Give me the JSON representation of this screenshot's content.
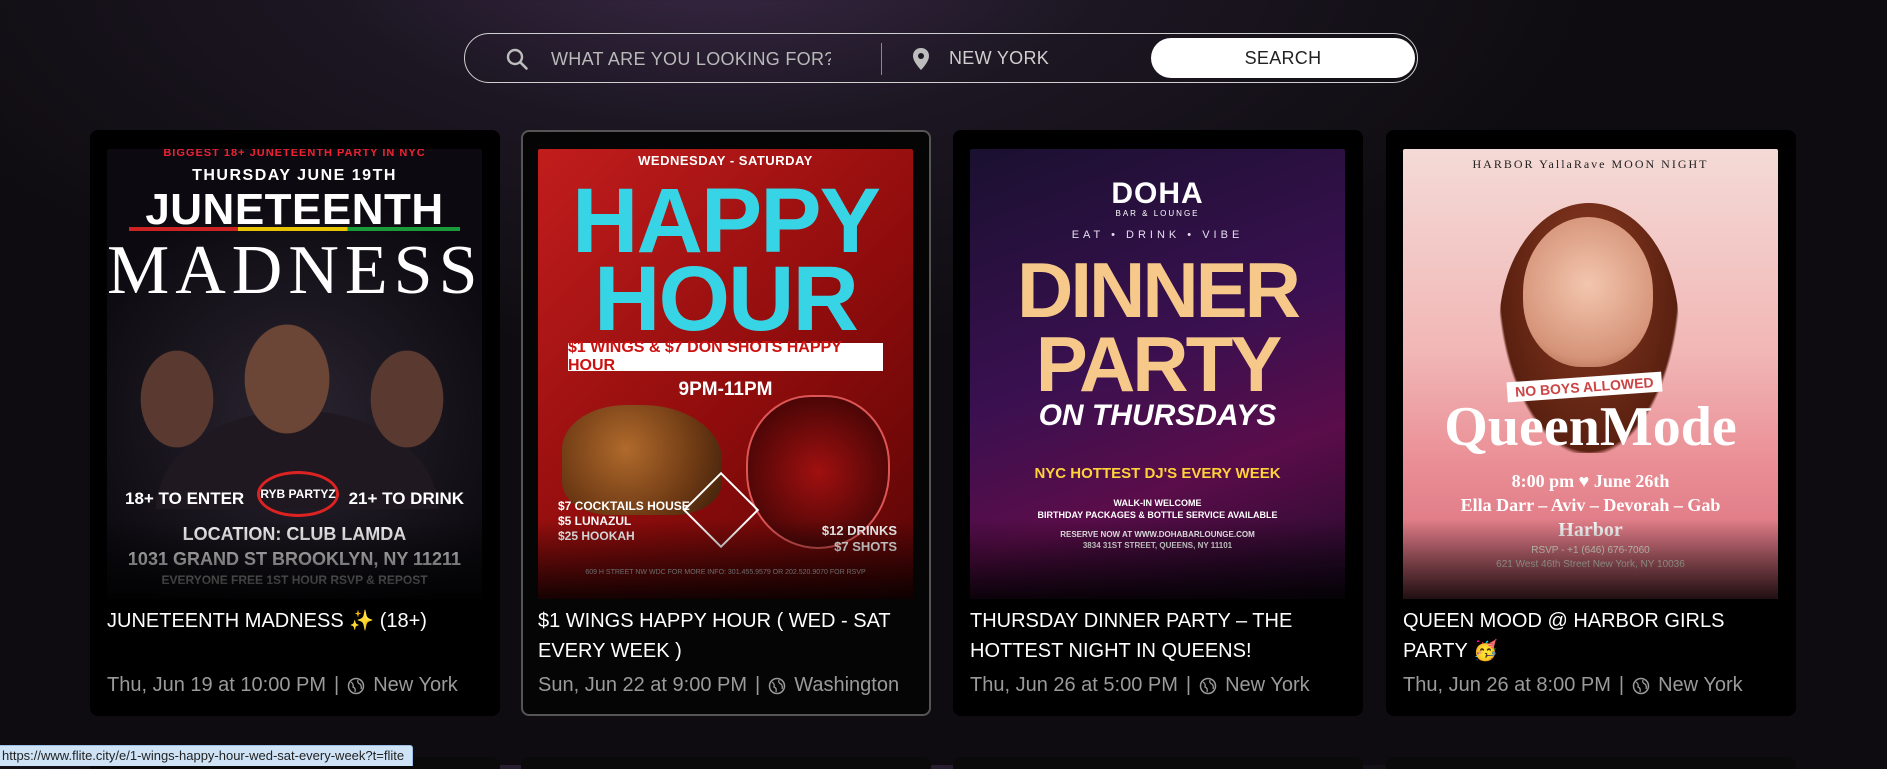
{
  "search": {
    "placeholder": "WHAT ARE YOU LOOKING FOR?",
    "location": "NEW YORK",
    "button_label": "SEARCH"
  },
  "events": [
    {
      "title": "JUNETEENTH MADNESS ✨ (18+)",
      "date": "Thu, Jun 19 at 10:00 PM",
      "city": "New York",
      "poster": {
        "top_line": "BIGGEST 18+ JUNETEENTH PARTY IN NYC",
        "date_line": "THURSDAY JUNE 19TH",
        "headline_1": "JUNETEENTH",
        "headline_2": "MADNESS",
        "left_text": "18+ TO ENTER",
        "right_text": "21+ TO DRINK",
        "logo_text": "RYB PARTYZ",
        "location": "LOCATION: CLUB LAMDA",
        "address": "1031 GRAND ST BROOKLYN, NY 11211",
        "footer": "EVERYONE FREE 1ST HOUR RSVP & REPOST"
      }
    },
    {
      "title": "$1 WINGS HAPPY HOUR ( WED - SAT EVERY WEEK )",
      "date": "Sun, Jun 22 at 9:00 PM",
      "city": "Washington",
      "poster": {
        "days": "WEDNESDAY - SATURDAY",
        "headline_1": "HAPPY",
        "headline_2": "HOUR",
        "banner": "$1 WINGS & $7 DON SHOTS HAPPY HOUR",
        "time": "9PM-11PM",
        "list": [
          "$7 COCKTAILS HOUSE",
          "$5 LUNAZUL",
          "$25 HOOKAH"
        ],
        "drinks": [
          "$12 DRINKS",
          "$7 SHOTS"
        ],
        "small": "609 H STREET NW WDC  FOR MORE INFO: 301.455.9579  OR 202.520.9070 FOR RSVP"
      }
    },
    {
      "title": "THURSDAY DINNER PARTY – THE HOTTEST NIGHT IN QUEENS!",
      "date": "Thu, Jun 26 at 5:00 PM",
      "city": "New York",
      "poster": {
        "brand": "DOHA",
        "brand_sub": "BAR & LOUNGE",
        "tagline": "EAT • DRINK • VIBE",
        "headline_1": "DINNER",
        "headline_2": "PARTY",
        "headline_3": "ON THURSDAYS",
        "djs": "NYC HOTTEST DJ'S EVERY WEEK",
        "walk_in": "WALK-IN WELCOME",
        "services": "BIRTHDAY PACKAGES & BOTTLE SERVICE AVAILABLE",
        "reserve": "RESERVE NOW AT WWW.DOHABARLOUNGE.COM",
        "address": "3834 31ST STREET, QUEENS, NY 11101"
      }
    },
    {
      "title": "QUEEN MOOD @ HARBOR GIRLS PARTY 🥳",
      "date": "Thu, Jun 26 at 8:00 PM",
      "city": "New York",
      "poster": {
        "logos": "HARBOR   YallaRave   MOON NIGHT",
        "badge": "NO BOYS ALLOWED",
        "headline": "QueenMode",
        "when": "8:00 pm  ♥  June 26th",
        "names": "Ella Darr – Aviv – Devorah – Gab",
        "venue": "Harbor",
        "rsvp": "RSVP - +1 (646) 676-7060",
        "street": "621 West 46th Street New York, NY 10036"
      }
    }
  ],
  "status_url": "https://www.flite.city/e/1-wings-happy-hour-wed-sat-every-week?t=flite",
  "colors": {
    "accent_cyan": "#37d4e6",
    "card_bg": "#000000",
    "meta_text": "#9a9a9a"
  }
}
